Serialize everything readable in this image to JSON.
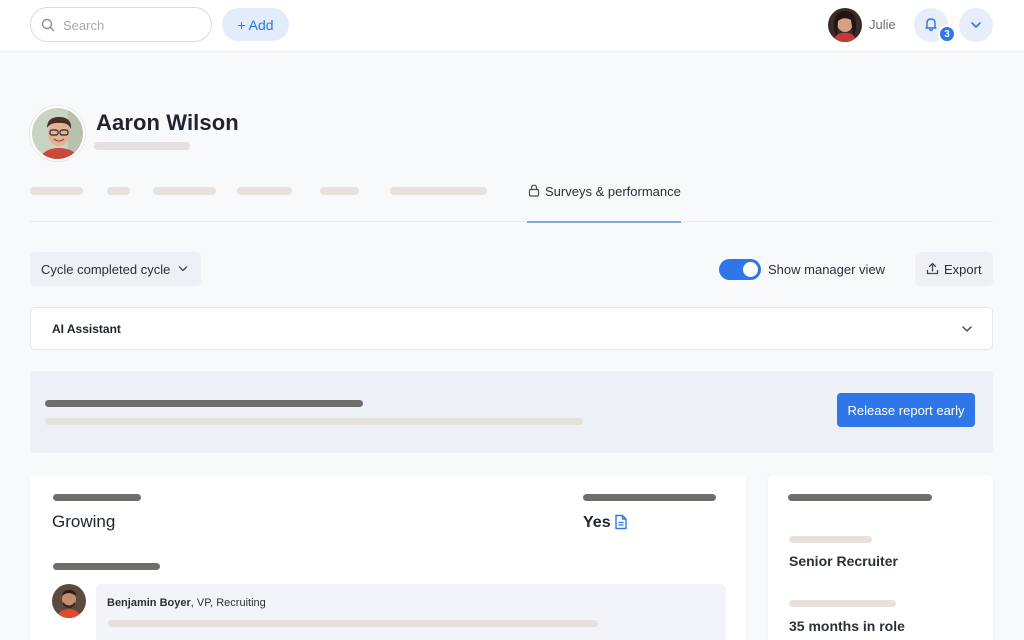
{
  "header": {
    "search_placeholder": "Search",
    "add_label": "+ Add",
    "user_name": "Julie",
    "notification_count": "3"
  },
  "profile": {
    "name": "Aaron Wilson"
  },
  "tabs": {
    "active_label": "Surveys & performance"
  },
  "controls": {
    "cycle_label": "Cycle completed cycle",
    "manager_view_label": "Show manager view",
    "manager_view_on": true,
    "export_label": "Export"
  },
  "ai_assistant": {
    "title": "AI Assistant"
  },
  "release": {
    "button_label": "Release report early"
  },
  "summary": {
    "status_value": "Growing",
    "flag_value": "Yes"
  },
  "comment": {
    "author_name": "Benjamin Boyer",
    "author_title": ", VP, Recruiting"
  },
  "side_card": {
    "role": "Senior Recruiter",
    "tenure": "35 months in role"
  },
  "colors": {
    "accent": "#2f76e8",
    "accent_light": "#e3ecfb",
    "panel_bg": "#edf0f6",
    "placeholder_light": "#e7e1dd",
    "placeholder_dark": "#6f6e6b"
  }
}
